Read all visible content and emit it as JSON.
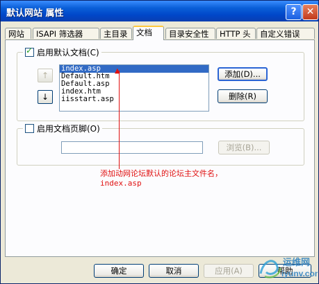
{
  "window": {
    "title": "默认网站 属性",
    "help_label": "?",
    "close_label": "✕"
  },
  "tabs": [
    {
      "label": "网站"
    },
    {
      "label": "ISAPI 筛选器"
    },
    {
      "label": "主目录"
    },
    {
      "label": "文档"
    },
    {
      "label": "目录安全性"
    },
    {
      "label": "HTTP 头"
    },
    {
      "label": "自定义错误"
    }
  ],
  "active_tab": "文档",
  "default_doc": {
    "enable_label": "启用默认文档(C)",
    "checked": true,
    "items": [
      "index.asp",
      "Default.htm",
      "Default.asp",
      "index.htm",
      "iisstart.asp"
    ],
    "selected": "index.asp",
    "up_icon": "↑",
    "down_icon": "↓",
    "add_label": "添加(D)...",
    "remove_label": "删除(R)"
  },
  "footer_doc": {
    "enable_label": "启用文档页脚(O)",
    "checked": false,
    "path_value": "",
    "browse_label": "浏览(B)..."
  },
  "annotation": {
    "line1": "添加动网论坛默认的论坛主文件名，",
    "line2": "index.asp"
  },
  "buttons": {
    "ok": "确定",
    "cancel": "取消",
    "apply": "应用(A)",
    "help": "帮助"
  },
  "watermark": {
    "line1": "运维网",
    "line2": "iyunv.com"
  }
}
